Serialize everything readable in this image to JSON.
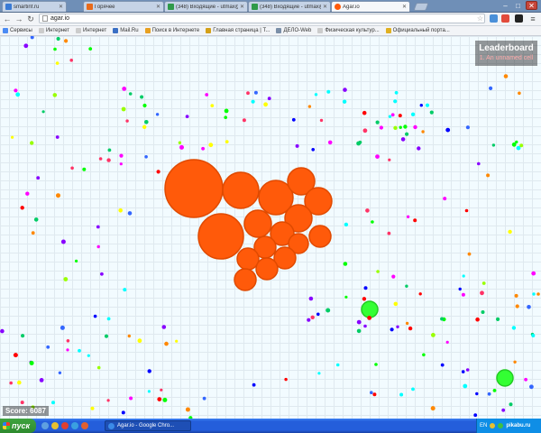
{
  "browser": {
    "tabs": [
      {
        "title": "smartinf.ru",
        "favicon_color": "#3a7bd5",
        "active": false
      },
      {
        "title": "Горячее",
        "favicon_color": "#e86a1a",
        "active": false
      },
      {
        "title": "(348) Входящие - utmax@i...",
        "favicon_color": "#2f9a4a",
        "active": false
      },
      {
        "title": "(348) Входящие - utmax@i...",
        "favicon_color": "#2f9a4a",
        "active": false
      },
      {
        "title": "Agar.io",
        "favicon_color": "#ff5a0a",
        "active": true
      }
    ],
    "address": "agar.io",
    "bookmarks": [
      {
        "label": "Сервисы",
        "icon_color": "#4b8bf4"
      },
      {
        "label": "Интернет",
        "icon_color": "#cccccc"
      },
      {
        "label": "Интернет",
        "icon_color": "#cccccc"
      },
      {
        "label": "Mail.Ru",
        "icon_color": "#3a6fc4"
      },
      {
        "label": "Поиск в Интернете",
        "icon_color": "#e8a020"
      },
      {
        "label": "Главная страница | T...",
        "icon_color": "#d4a017"
      },
      {
        "label": "ДЕЛО-Web",
        "icon_color": "#7b8fa8"
      },
      {
        "label": "Физическая культур...",
        "icon_color": "#cccccc"
      },
      {
        "label": "Официальный порта...",
        "icon_color": "#e0b020"
      }
    ]
  },
  "game": {
    "leaderboard_title": "Leaderboard",
    "leaderboard_entries": [
      "1. An unnamed cell"
    ],
    "score": "Score: 6087",
    "player_color": "#ff5a0a",
    "green_virus_color": "#33ff33"
  },
  "taskbar": {
    "start_label": "пуск",
    "window_label": "Agar.io - Google Chro...",
    "tray_lang": "EN",
    "watermark": "pikabu.ru"
  },
  "icons": [
    "back-icon",
    "forward-icon",
    "reload-icon",
    "star-icon",
    "close-icon",
    "menu-icon"
  ]
}
